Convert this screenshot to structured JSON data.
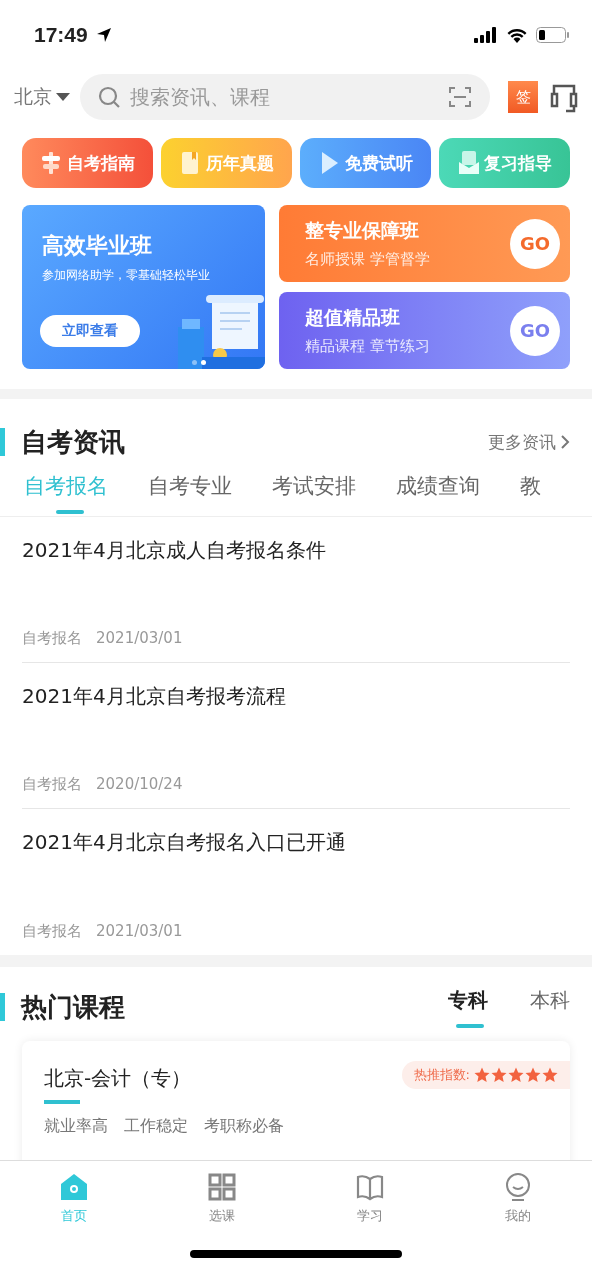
{
  "status_bar": {
    "time": "17:49"
  },
  "header": {
    "city": "北京",
    "search": {
      "placeholder": "搜索资讯、课程"
    },
    "sign_badge": "签"
  },
  "shortcuts": [
    {
      "label": "自考指南",
      "kind": "guide"
    },
    {
      "label": "历年真题",
      "kind": "exam"
    },
    {
      "label": "免费试听",
      "kind": "play"
    },
    {
      "label": "复习指导",
      "kind": "review"
    }
  ],
  "banner": {
    "title": "高效毕业班",
    "subtitle": "参加网络助学，零基础轻松毕业",
    "button": "立即查看",
    "pages": [
      {
        "selected": false
      },
      {
        "selected": true
      }
    ]
  },
  "promo_cards": [
    {
      "title": "整专业保障班",
      "subtitle": "名师授课 学管督学",
      "button": "GO",
      "kind": "orange"
    },
    {
      "title": "超值精品班",
      "subtitle": "精品课程 章节练习",
      "button": "GO",
      "kind": "purple"
    }
  ],
  "news": {
    "title": "自考资讯",
    "more": "更多资讯",
    "tabs": [
      {
        "label": "自考报名",
        "selected": true
      },
      {
        "label": "自考专业",
        "selected": false
      },
      {
        "label": "考试安排",
        "selected": false
      },
      {
        "label": "成绩查询",
        "selected": false
      },
      {
        "label": "教",
        "selected": false
      }
    ],
    "items": [
      {
        "title": "2021年4月北京成人自考报名条件",
        "category": "自考报名",
        "date": "2021/03/01"
      },
      {
        "title": "2021年4月北京自考报考流程",
        "category": "自考报名",
        "date": "2020/10/24"
      },
      {
        "title": "2021年4月北京自考报名入口已开通",
        "category": "自考报名",
        "date": "2021/03/01"
      }
    ]
  },
  "courses": {
    "title": "热门课程",
    "tabs": [
      {
        "label": "专科",
        "selected": true
      },
      {
        "label": "本科",
        "selected": false
      }
    ],
    "card": {
      "title": "北京-会计（专）",
      "hot_label": "热推指数:",
      "stars": 5,
      "tags": "就业率高　工作稳定　考职称必备"
    }
  },
  "tab_bar": [
    {
      "label": "首页",
      "kind": "home",
      "selected": true
    },
    {
      "label": "选课",
      "kind": "grid",
      "selected": false
    },
    {
      "label": "学习",
      "kind": "book",
      "selected": false
    },
    {
      "label": "我的",
      "kind": "smile",
      "selected": false
    }
  ]
}
